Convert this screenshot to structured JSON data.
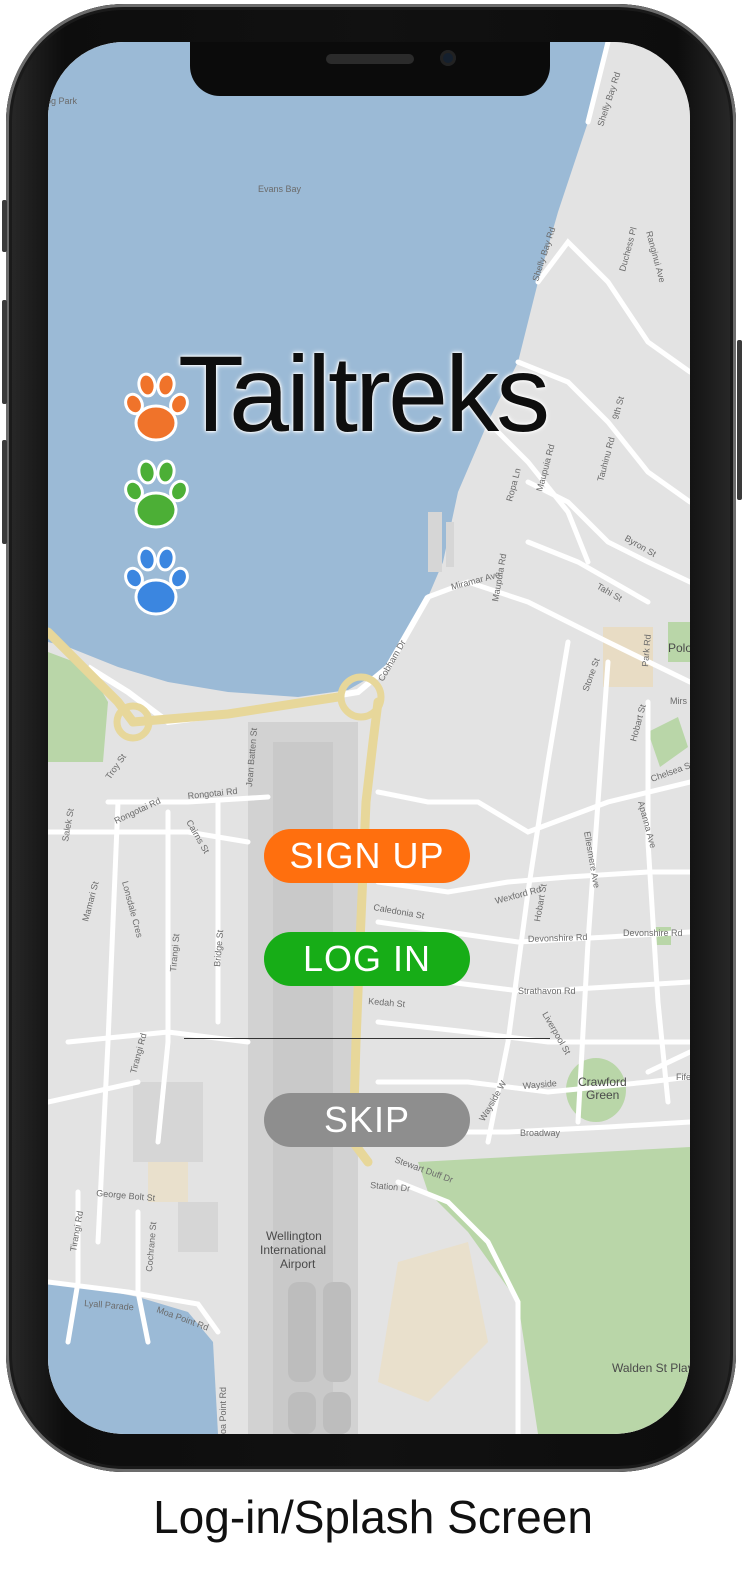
{
  "app": {
    "logo_text": "Tailtreks",
    "caption": "Log-in/Splash Screen"
  },
  "paw_icons": [
    {
      "name": "orange-paw-icon",
      "color": "#f0732a"
    },
    {
      "name": "green-paw-icon",
      "color": "#4caf36"
    },
    {
      "name": "blue-paw-icon",
      "color": "#3b86e0"
    }
  ],
  "buttons": {
    "signup_label": "SIGN UP",
    "login_label": "LOG IN",
    "skip_label": "SKIP"
  },
  "colors": {
    "signup": "#ff6f0e",
    "login": "#17ad17",
    "skip": "#8e8e8e",
    "water": "#9bbad6",
    "land": "#e3e3e3",
    "park": "#b9d6a8",
    "highway": "#e7d79a"
  },
  "map_labels": {
    "evans_bay": "Evans Bay",
    "og_park": "og Park",
    "shelly_bay_rd": "Shelly Bay Rd",
    "shelly_bay_rd_2": "Shelly Bay Rd",
    "ranginui_ave": "Ranginui Ave",
    "duchess_pl": "Duchess Pl",
    "miramar_ave": "Miramar Ave",
    "cobham_dr": "Cobham Dr",
    "maupuia_rd": "Maupuia Rd",
    "maupuia_rd_2": "Maupuia Rd",
    "ropa_ln": "Ropa Ln",
    "tauhinu_rd": "Tauhinu Rd",
    "ninth_st": "9th St",
    "byron_st": "Byron St",
    "tahi_st": "Tahi St",
    "polo": "Polo",
    "mirs": "Mirs",
    "park_rd": "Park Rd",
    "stone_st": "Stone St",
    "hobart_st": "Hobart St",
    "chelsea_st": "Chelsea St",
    "troy_st": "Troy St",
    "rongotai_rd": "Rongotai Rd",
    "rongotai_rd_2": "Rongotai Rd",
    "jean_batten_st": "Jean Batten St",
    "cairns_st": "Cairns St",
    "salek_st": "Salek St",
    "wexford_rd": "Wexford Rd",
    "hobart_st_2": "Hobart St",
    "ellesmere_ave": "Ellesmere Ave",
    "apanna_ave": "Apanna Ave",
    "caledonia_st": "Caledonia St",
    "devonshire_rd": "Devonshire Rd",
    "devonshire_rd_2": "Devonshire Rd",
    "lonsdale_cres": "Lonsdale Cres",
    "mamari_st": "Mamari St",
    "tirangi_st": "Tirangi St",
    "bridge_st": "Bridge St",
    "strathavon_rd": "Strathavon Rd",
    "kedah_st": "Kedah St",
    "liverpool_st": "Liverpool St",
    "tirangi_rd": "Tirangi Rd",
    "wayside": "Wayside",
    "wayside_w": "Wayside W",
    "crawford": "Crawford",
    "green": "Green",
    "fife": "Fife",
    "broadway": "Broadway",
    "stewart_duff_dr": "Stewart Duff Dr",
    "station_dr": "Station Dr",
    "george_bolt_st": "George Bolt St",
    "tirangi_rd_2": "Tirangi Rd",
    "cochrane_st": "Cochrane St",
    "wellington": "Wellington",
    "international": "International",
    "airport": "Airport",
    "lyall_parade": "Lyall Parade",
    "moa_point_rd": "Moa Point Rd",
    "moa_point_rd_2": "oa Point Rd",
    "walden_st_playg": "Walden St Playg"
  }
}
